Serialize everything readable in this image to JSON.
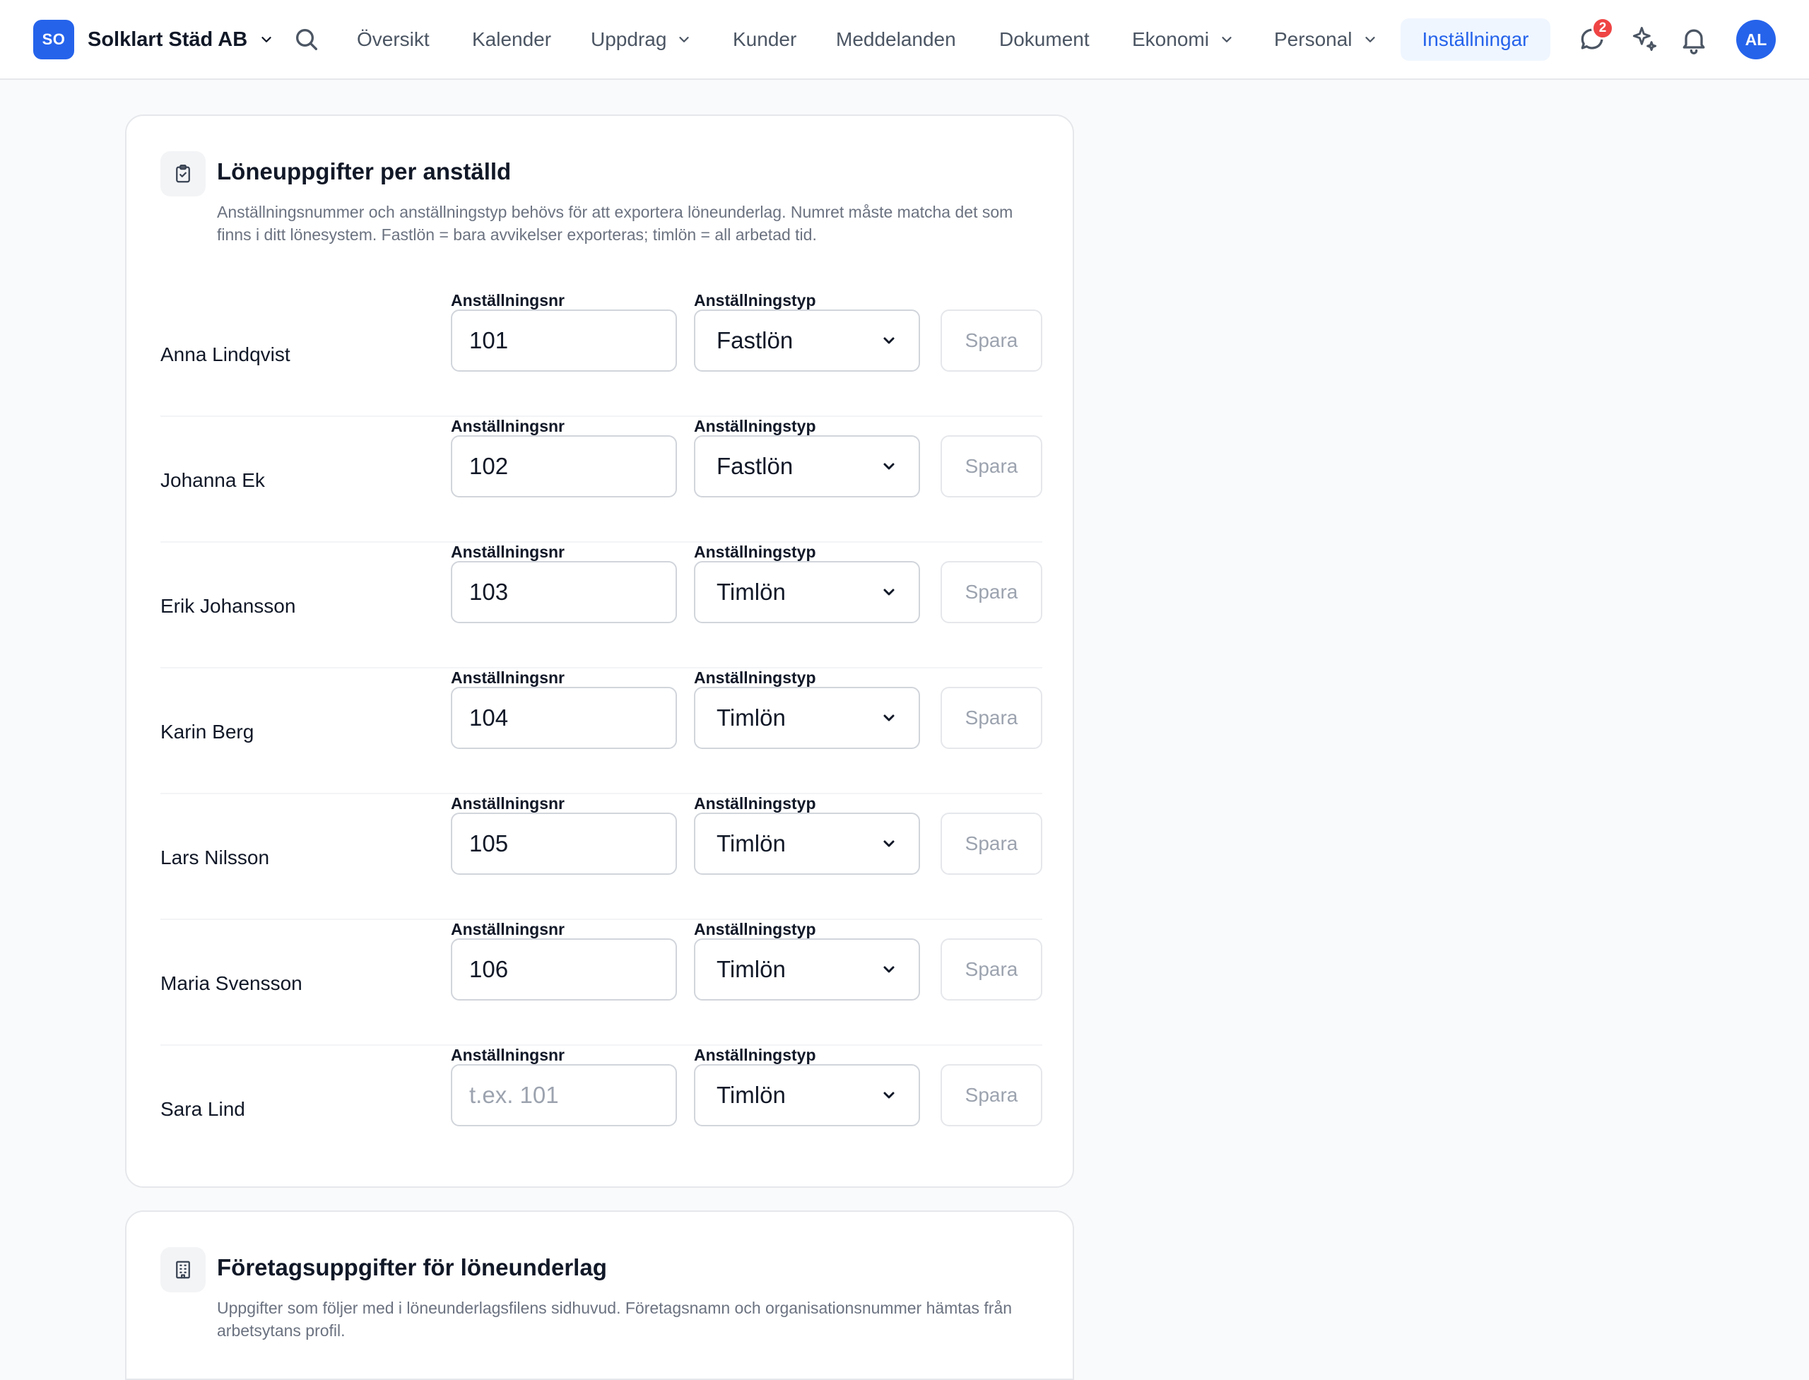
{
  "header": {
    "logo": "SO",
    "org_name": "Solklart Städ AB",
    "nav": [
      "Översikt",
      "Kalender",
      "Uppdrag",
      "Kunder",
      "Meddelanden",
      "Dokument",
      "Ekonomi",
      "Personal",
      "Inställningar"
    ],
    "active_nav": "Inställningar",
    "messages_badge": "2",
    "avatar": "AL",
    "accent_color": "#2563eb"
  },
  "payroll_card": {
    "title": "Löneuppgifter per anställd",
    "description": "Anställningsnummer och anställningstyp behövs för att exportera löneunderlag. Numret måste matcha det som finns i ditt lönesystem. Fastlön = bara avvikelser exporteras; timlön = all arbetad tid.",
    "number_label": "Anställningsnr",
    "type_label": "Anställningstyp",
    "save_label": "Spara",
    "number_placeholder": "t.ex. 101",
    "employees": [
      {
        "name": "Anna Lindqvist",
        "number": "101",
        "type": "Fastlön"
      },
      {
        "name": "Johanna Ek",
        "number": "102",
        "type": "Fastlön"
      },
      {
        "name": "Erik Johansson",
        "number": "103",
        "type": "Timlön"
      },
      {
        "name": "Karin Berg",
        "number": "104",
        "type": "Timlön"
      },
      {
        "name": "Lars Nilsson",
        "number": "105",
        "type": "Timlön"
      },
      {
        "name": "Maria Svensson",
        "number": "106",
        "type": "Timlön"
      },
      {
        "name": "Sara Lind",
        "number": "",
        "type": "Timlön"
      }
    ]
  },
  "company_card": {
    "title": "Företagsuppgifter för löneunderlag",
    "description": "Uppgifter som följer med i löneunderlagsfilens sidhuvud. Företagsnamn och organisationsnummer hämtas från arbetsytans profil."
  }
}
